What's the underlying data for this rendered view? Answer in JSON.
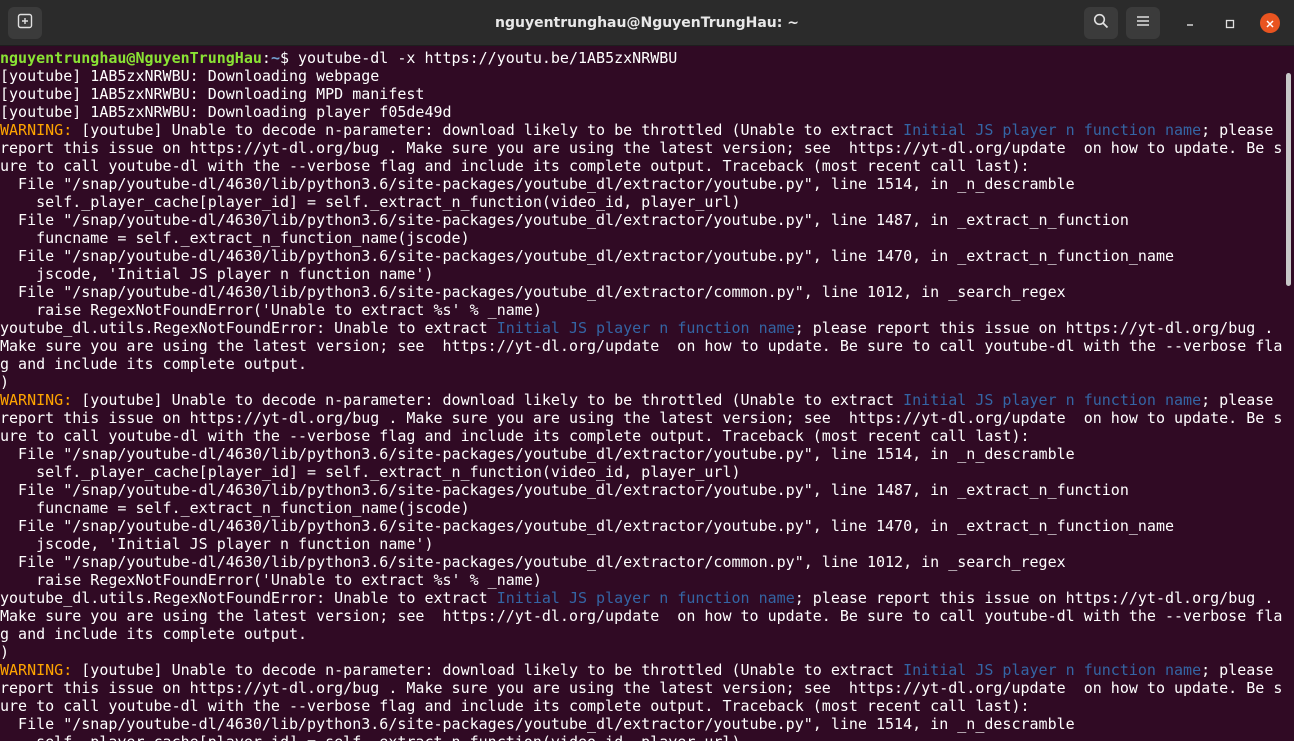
{
  "window": {
    "title": "nguyentrunghau@NguyenTrungHau: ~"
  },
  "icons": {
    "new_tab": "new-tab-icon",
    "search": "search-icon",
    "menu": "hamburger-menu-icon",
    "minimize": "minimize-icon",
    "maximize": "maximize-icon",
    "close": "close-icon"
  },
  "colors": {
    "background": "#300a24",
    "prompt_user": "#8ae234",
    "prompt_path": "#729fcf",
    "warning": "#ffa500",
    "highlight": "#3465a4",
    "text": "#ffffff",
    "close_button": "#e95420"
  },
  "terminal": {
    "prompt": {
      "user_host": "nguyentrunghau@NguyenTrungHau",
      "path": "~",
      "command": "$ youtube-dl -x https://youtu.be/1AB5zxNRWBU"
    },
    "lines": [
      {
        "segments": [
          {
            "text": "[youtube] 1AB5zxNRWBU: Downloading webpage"
          }
        ]
      },
      {
        "segments": [
          {
            "text": "[youtube] 1AB5zxNRWBU: Downloading MPD manifest"
          }
        ]
      },
      {
        "segments": [
          {
            "text": "[youtube] 1AB5zxNRWBU: Downloading player f05de49d"
          }
        ]
      },
      {
        "segments": [
          {
            "text": "WARNING:",
            "style": "warning"
          },
          {
            "text": " [youtube] Unable to decode n-parameter: download likely to be throttled (Unable to extract "
          },
          {
            "text": "Initial JS player n function name",
            "style": "highlight"
          },
          {
            "text": "; please"
          }
        ]
      },
      {
        "segments": [
          {
            "text": "report this issue on https://yt-dl.org/bug . Make sure you are using the latest version; see  https://yt-dl.org/update  on how to update. Be s"
          }
        ]
      },
      {
        "segments": [
          {
            "text": "ure to call youtube-dl with the --verbose flag and include its complete output. Traceback (most recent call last):"
          }
        ]
      },
      {
        "segments": [
          {
            "text": "  File \"/snap/youtube-dl/4630/lib/python3.6/site-packages/youtube_dl/extractor/youtube.py\", line 1514, in _n_descramble"
          }
        ]
      },
      {
        "segments": [
          {
            "text": "    self._player_cache[player_id] = self._extract_n_function(video_id, player_url)"
          }
        ]
      },
      {
        "segments": [
          {
            "text": "  File \"/snap/youtube-dl/4630/lib/python3.6/site-packages/youtube_dl/extractor/youtube.py\", line 1487, in _extract_n_function"
          }
        ]
      },
      {
        "segments": [
          {
            "text": "    funcname = self._extract_n_function_name(jscode)"
          }
        ]
      },
      {
        "segments": [
          {
            "text": "  File \"/snap/youtube-dl/4630/lib/python3.6/site-packages/youtube_dl/extractor/youtube.py\", line 1470, in _extract_n_function_name"
          }
        ]
      },
      {
        "segments": [
          {
            "text": "    jscode, 'Initial JS player n function name')"
          }
        ]
      },
      {
        "segments": [
          {
            "text": "  File \"/snap/youtube-dl/4630/lib/python3.6/site-packages/youtube_dl/extractor/common.py\", line 1012, in _search_regex"
          }
        ]
      },
      {
        "segments": [
          {
            "text": "    raise RegexNotFoundError('Unable to extract %s' % _name)"
          }
        ]
      },
      {
        "segments": [
          {
            "text": "youtube_dl.utils.RegexNotFoundError: Unable to extract "
          },
          {
            "text": "Initial JS player n function name",
            "style": "highlight"
          },
          {
            "text": "; please report this issue on https://yt-dl.org/bug ."
          }
        ]
      },
      {
        "segments": [
          {
            "text": "Make sure you are using the latest version; see  https://yt-dl.org/update  on how to update. Be sure to call youtube-dl with the --verbose fla"
          }
        ]
      },
      {
        "segments": [
          {
            "text": "g and include its complete output."
          }
        ]
      },
      {
        "segments": [
          {
            "text": ")"
          }
        ]
      },
      {
        "segments": [
          {
            "text": "WARNING:",
            "style": "warning"
          },
          {
            "text": " [youtube] Unable to decode n-parameter: download likely to be throttled (Unable to extract "
          },
          {
            "text": "Initial JS player n function name",
            "style": "highlight"
          },
          {
            "text": "; please"
          }
        ]
      },
      {
        "segments": [
          {
            "text": "report this issue on https://yt-dl.org/bug . Make sure you are using the latest version; see  https://yt-dl.org/update  on how to update. Be s"
          }
        ]
      },
      {
        "segments": [
          {
            "text": "ure to call youtube-dl with the --verbose flag and include its complete output. Traceback (most recent call last):"
          }
        ]
      },
      {
        "segments": [
          {
            "text": "  File \"/snap/youtube-dl/4630/lib/python3.6/site-packages/youtube_dl/extractor/youtube.py\", line 1514, in _n_descramble"
          }
        ]
      },
      {
        "segments": [
          {
            "text": "    self._player_cache[player_id] = self._extract_n_function(video_id, player_url)"
          }
        ]
      },
      {
        "segments": [
          {
            "text": "  File \"/snap/youtube-dl/4630/lib/python3.6/site-packages/youtube_dl/extractor/youtube.py\", line 1487, in _extract_n_function"
          }
        ]
      },
      {
        "segments": [
          {
            "text": "    funcname = self._extract_n_function_name(jscode)"
          }
        ]
      },
      {
        "segments": [
          {
            "text": "  File \"/snap/youtube-dl/4630/lib/python3.6/site-packages/youtube_dl/extractor/youtube.py\", line 1470, in _extract_n_function_name"
          }
        ]
      },
      {
        "segments": [
          {
            "text": "    jscode, 'Initial JS player n function name')"
          }
        ]
      },
      {
        "segments": [
          {
            "text": "  File \"/snap/youtube-dl/4630/lib/python3.6/site-packages/youtube_dl/extractor/common.py\", line 1012, in _search_regex"
          }
        ]
      },
      {
        "segments": [
          {
            "text": "    raise RegexNotFoundError('Unable to extract %s' % _name)"
          }
        ]
      },
      {
        "segments": [
          {
            "text": "youtube_dl.utils.RegexNotFoundError: Unable to extract "
          },
          {
            "text": "Initial JS player n function name",
            "style": "highlight"
          },
          {
            "text": "; please report this issue on https://yt-dl.org/bug ."
          }
        ]
      },
      {
        "segments": [
          {
            "text": "Make sure you are using the latest version; see  https://yt-dl.org/update  on how to update. Be sure to call youtube-dl with the --verbose fla"
          }
        ]
      },
      {
        "segments": [
          {
            "text": "g and include its complete output."
          }
        ]
      },
      {
        "segments": [
          {
            "text": ")"
          }
        ]
      },
      {
        "segments": [
          {
            "text": "WARNING:",
            "style": "warning"
          },
          {
            "text": " [youtube] Unable to decode n-parameter: download likely to be throttled (Unable to extract "
          },
          {
            "text": "Initial JS player n function name",
            "style": "highlight"
          },
          {
            "text": "; please"
          }
        ]
      },
      {
        "segments": [
          {
            "text": "report this issue on https://yt-dl.org/bug . Make sure you are using the latest version; see  https://yt-dl.org/update  on how to update. Be s"
          }
        ]
      },
      {
        "segments": [
          {
            "text": "ure to call youtube-dl with the --verbose flag and include its complete output. Traceback (most recent call last):"
          }
        ]
      },
      {
        "segments": [
          {
            "text": "  File \"/snap/youtube-dl/4630/lib/python3.6/site-packages/youtube_dl/extractor/youtube.py\", line 1514, in _n_descramble"
          }
        ]
      },
      {
        "segments": [
          {
            "text": "    self._player_cache[player_id] = self._extract_n_function(video_id, player_url)"
          }
        ]
      }
    ]
  }
}
